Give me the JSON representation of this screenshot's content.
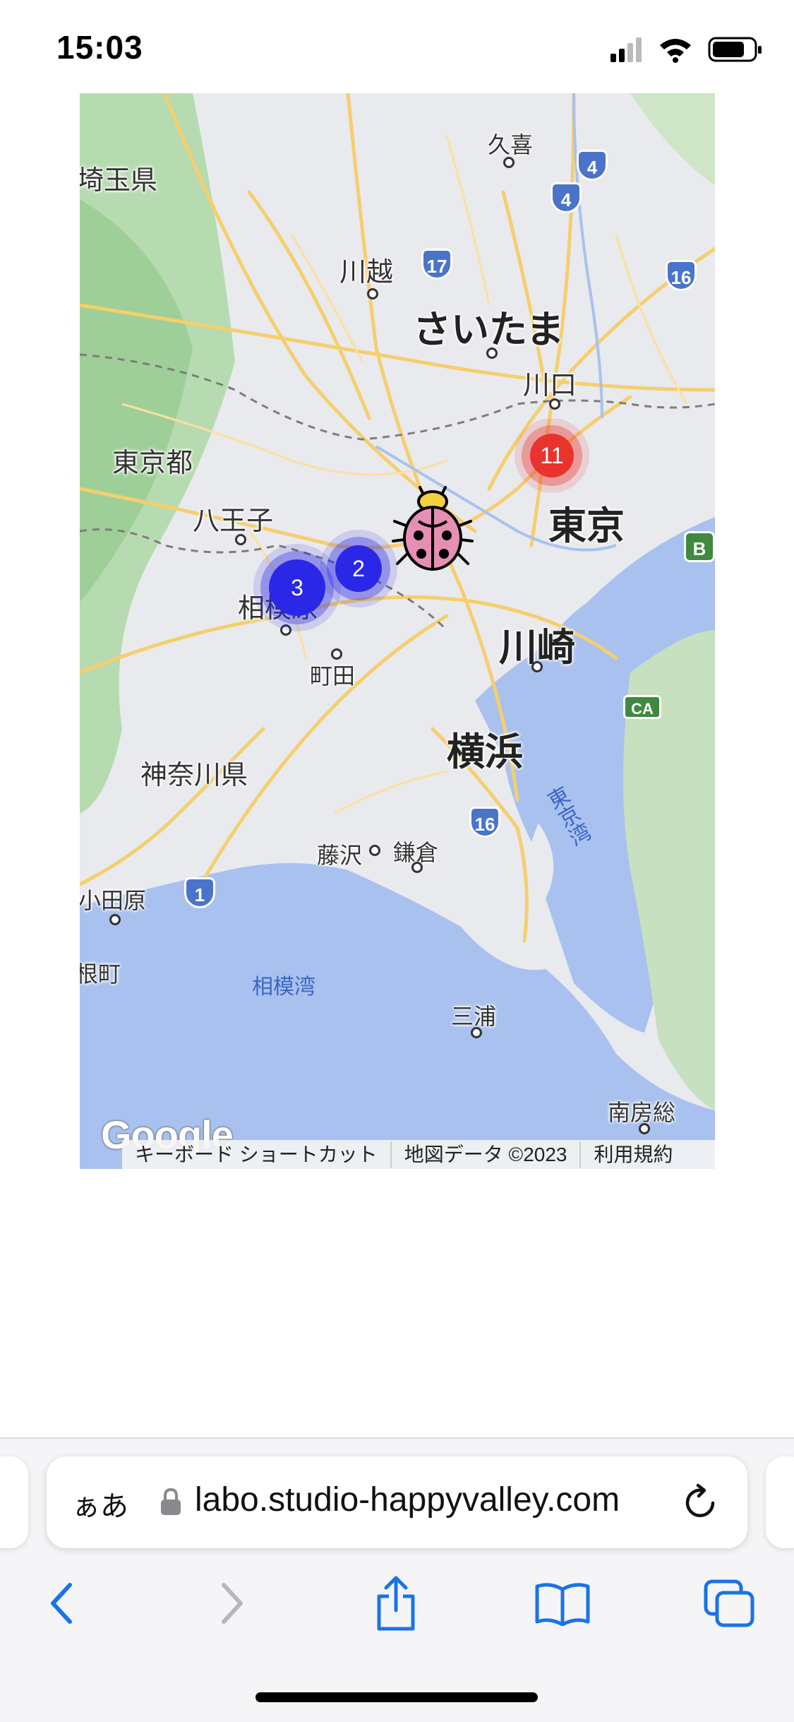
{
  "status": {
    "time": "15:03"
  },
  "map": {
    "places": {
      "saitama_ken": "埼玉県",
      "kuki": "久喜",
      "kawagoe": "川越",
      "saitama": "さいたま",
      "kawaguchi": "川口",
      "tokyo_to": "東京都",
      "hachioji": "八王子",
      "tokyo": "東京",
      "sagamihara": "相模原",
      "machida": "町田",
      "kawasaki": "川崎",
      "kanagawa_ken": "神奈川県",
      "yokohama": "横浜",
      "fujisawa": "藤沢",
      "kamakura": "鎌倉",
      "odawara": "小田原",
      "ne_machi": "根町",
      "sagami_bay": "相模湾",
      "tokyo_bay": "東京湾",
      "miura": "三浦",
      "minamiboso": "南房総"
    },
    "shields": {
      "r4a": "4",
      "r4b": "4",
      "r17": "17",
      "r16a": "16",
      "r16b": "16",
      "r1": "1",
      "b": "B",
      "ca": "CA"
    },
    "clusters": {
      "red_count": "11",
      "blue_large_count": "3",
      "blue_small_count": "2",
      "red_color": "#e8332e",
      "blue_color": "#2a28e6"
    },
    "marker_icon": "ladybug-icon",
    "google_logo": "Google",
    "attribution": {
      "keyboard": "キーボード ショートカット",
      "data": "地図データ ©2023",
      "terms": "利用規約"
    }
  },
  "browser": {
    "aa_label": "ぁあ",
    "url": "labo.studio-happyvalley.com",
    "icons": [
      "lock-icon",
      "reload-icon",
      "back-icon",
      "forward-icon",
      "share-icon",
      "bookmarks-icon",
      "tabs-icon"
    ]
  }
}
